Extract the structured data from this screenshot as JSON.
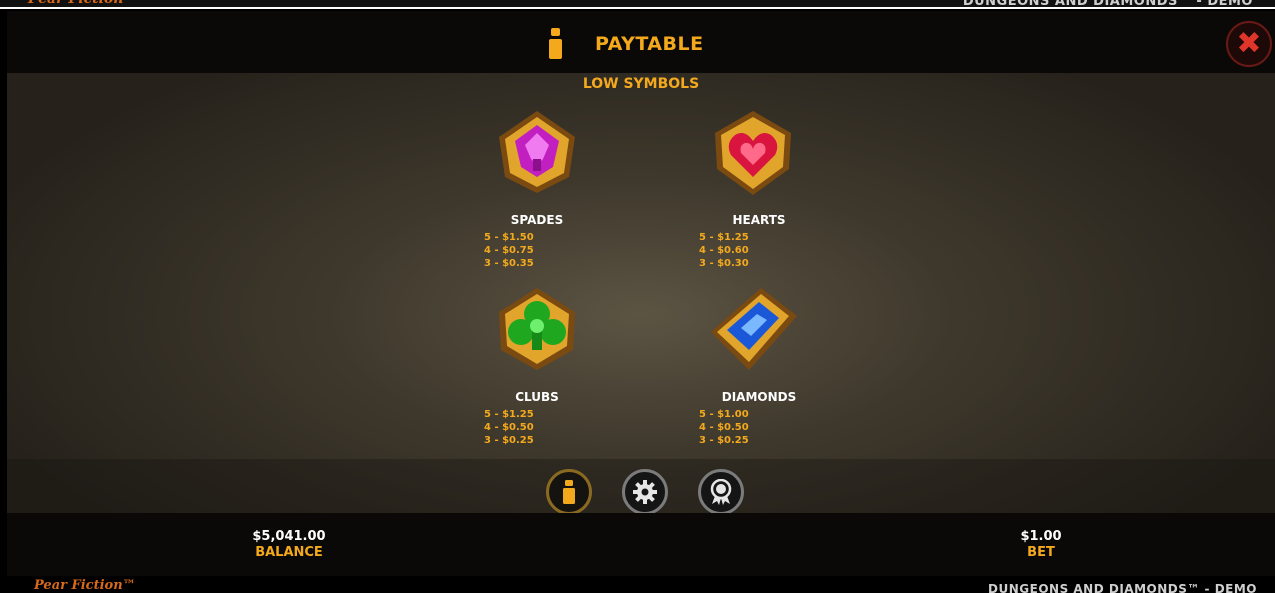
{
  "brand": {
    "name": "Pear Fiction™"
  },
  "game": {
    "title": "DUNGEONS AND DIAMONDS™ - DEMO"
  },
  "header": {
    "title": "PAYTABLE",
    "info_icon": "info-icon",
    "close_icon": "close-icon"
  },
  "section": {
    "title": "LOW SYMBOLS"
  },
  "symbols": [
    {
      "name": "SPADES",
      "color": "#c21fc0",
      "pays": [
        "5 - $1.50",
        "4 - $0.75",
        "3 - $0.35"
      ]
    },
    {
      "name": "HEARTS",
      "color": "#d8143f",
      "pays": [
        "5 - $1.25",
        "4 - $0.60",
        "3 - $0.30"
      ]
    },
    {
      "name": "CLUBS",
      "color": "#1fa81f",
      "pays": [
        "5 - $1.25",
        "4 - $0.50",
        "3 - $0.25"
      ]
    },
    {
      "name": "DIAMONDS",
      "color": "#1a58d8",
      "pays": [
        "5 - $1.00",
        "4 - $0.50",
        "3 - $0.25"
      ]
    }
  ],
  "bottom_buttons": [
    {
      "icon": "info-icon"
    },
    {
      "icon": "gear-icon"
    },
    {
      "icon": "history-icon"
    }
  ],
  "footer": {
    "balance_value": "$5,041.00",
    "balance_label": "BALANCE",
    "bet_value": "$1.00",
    "bet_label": "BET"
  },
  "colors": {
    "accent": "#f4a91d",
    "close": "#e0352b",
    "gold": "#d9a12a"
  }
}
